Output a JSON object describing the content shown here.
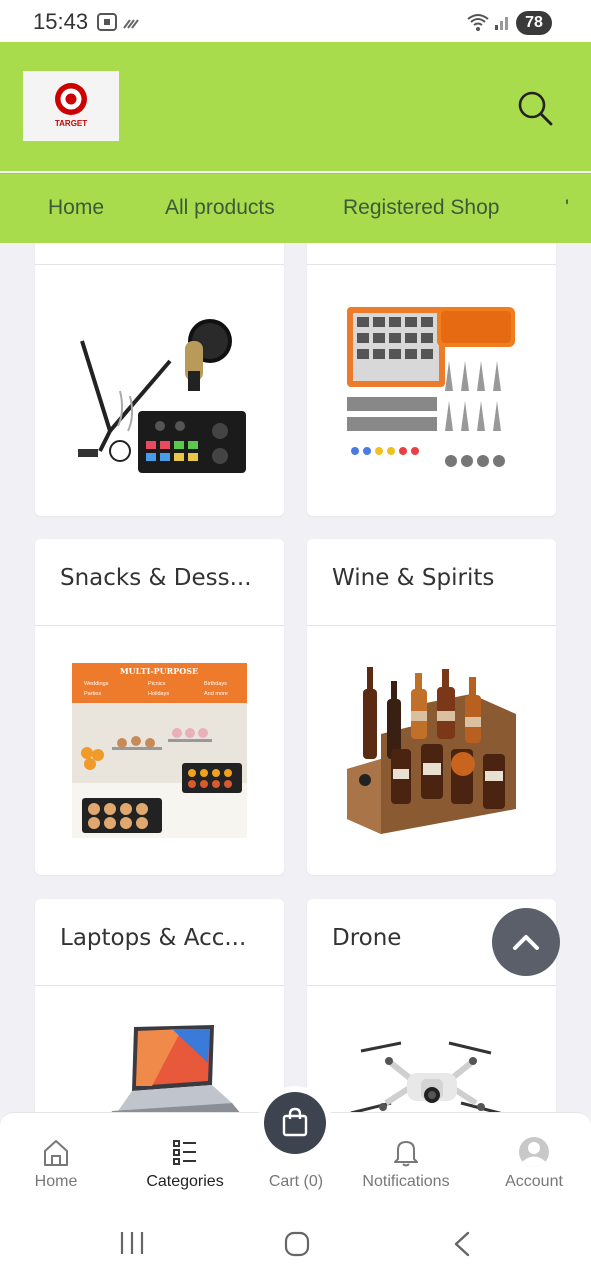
{
  "status_bar": {
    "time": "15:43",
    "battery": "78"
  },
  "header": {
    "logo_text": "TARGET"
  },
  "nav": {
    "items": [
      "Home",
      "All products",
      "Registered Shop"
    ]
  },
  "categories": [
    {
      "title": "",
      "image": "microphone-podcast-kit"
    },
    {
      "title": "",
      "image": "fishing-tackle-box"
    },
    {
      "title": "Snacks & Dess...",
      "image": "party-dessert-table",
      "image_text": "MULTI-PURPOSE"
    },
    {
      "title": "Wine & Spirits",
      "image": "liquor-bottles-rack"
    },
    {
      "title": "Laptops & Acc...",
      "image": "laptop-on-stand"
    },
    {
      "title": "Drone",
      "image": "quadcopter-drone"
    }
  ],
  "bottom_nav": {
    "items": [
      {
        "label": "Home",
        "icon": "home-icon"
      },
      {
        "label": "Categories",
        "icon": "list-icon",
        "active": true
      },
      {
        "label": "Cart (0)",
        "icon": "shopping-bag-icon"
      },
      {
        "label": "Notifications",
        "icon": "bell-icon"
      },
      {
        "label": "Account",
        "icon": "avatar-icon"
      }
    ]
  },
  "colors": {
    "brand_green": "#a8dc4c",
    "dark_button": "#3d4450",
    "background": "#f0f0f5"
  }
}
